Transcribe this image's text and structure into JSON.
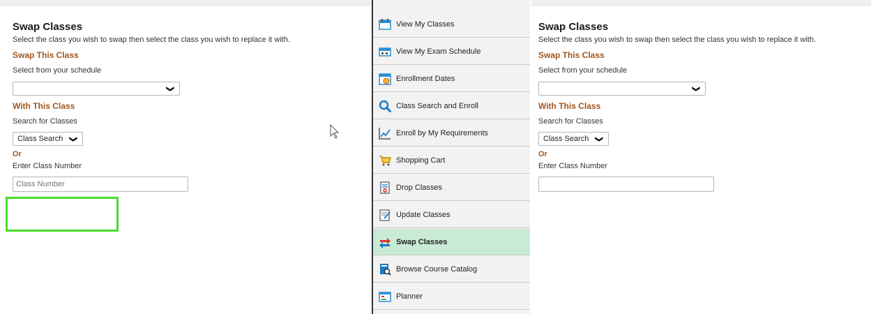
{
  "left_form": {
    "title": "Swap Classes",
    "description": "Select the class you wish to swap then select the class you wish to replace it with.",
    "swap_section": "Swap This Class",
    "schedule_label": "Select from your schedule",
    "schedule_value": "",
    "with_section": "With This Class",
    "search_label": "Search for Classes",
    "search_value": "Class Search",
    "or_label": "Or",
    "class_number_label": "Enter Class Number",
    "class_number_placeholder": "Class Number"
  },
  "right_form": {
    "title": "Swap Classes",
    "description": "Select the class you wish to swap then select the class you wish to replace it with.",
    "swap_section": "Swap This Class",
    "schedule_label": "Select from your schedule",
    "schedule_value": "",
    "with_section": "With This Class",
    "search_label": "Search for Classes",
    "search_value": "Class Search",
    "or_label": "Or",
    "class_number_label": "Enter Class Number",
    "class_number_placeholder": ""
  },
  "sidebar": {
    "items": [
      {
        "label": "View My Classes",
        "icon": "calendar-icon"
      },
      {
        "label": "View My Exam Schedule",
        "icon": "exam-schedule-icon"
      },
      {
        "label": "Enrollment Dates",
        "icon": "enrollment-dates-icon"
      },
      {
        "label": "Class Search and Enroll",
        "icon": "search-icon"
      },
      {
        "label": "Enroll by My Requirements",
        "icon": "line-chart-icon"
      },
      {
        "label": "Shopping Cart",
        "icon": "shopping-cart-icon"
      },
      {
        "label": "Drop Classes",
        "icon": "drop-classes-icon"
      },
      {
        "label": "Update Classes",
        "icon": "update-classes-icon"
      },
      {
        "label": "Swap Classes",
        "icon": "swap-icon",
        "active": true
      },
      {
        "label": "Browse Course Catalog",
        "icon": "catalog-icon"
      },
      {
        "label": "Planner",
        "icon": "planner-icon"
      }
    ]
  },
  "colors": {
    "section_heading": "#a0561e",
    "active_item": "#c9ead5",
    "highlight_box": "#4cdc2c"
  }
}
